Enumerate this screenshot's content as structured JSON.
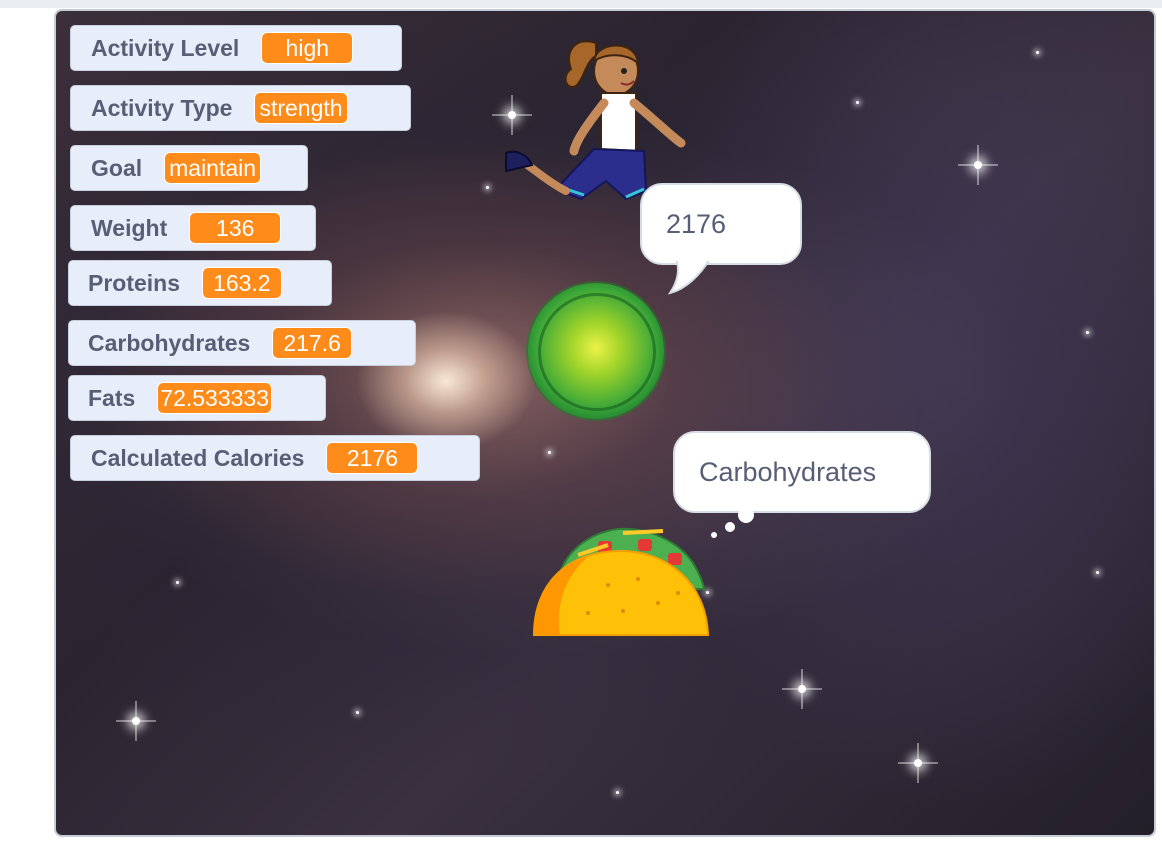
{
  "monitors": [
    {
      "label": "Activity Level",
      "value": "high"
    },
    {
      "label": "Activity Type",
      "value": "strength"
    },
    {
      "label": "Goal",
      "value": "maintain"
    },
    {
      "label": "Weight",
      "value": "136"
    },
    {
      "label": "Proteins",
      "value": "163.2"
    },
    {
      "label": "Carbohydrates",
      "value": "217.6"
    },
    {
      "label": "Fats",
      "value": "72.533333"
    },
    {
      "label": "Calculated Calories",
      "value": "2176"
    }
  ],
  "sprites": {
    "runner": {
      "name": "runner-girl",
      "say": "2176"
    },
    "orb": {
      "name": "green-button"
    },
    "taco": {
      "name": "taco",
      "think": "Carbohydrates"
    }
  },
  "colors": {
    "monitor_value_bg": "#ff8c1a",
    "monitor_bg": "#e7eef9",
    "label_text": "#575e75"
  }
}
